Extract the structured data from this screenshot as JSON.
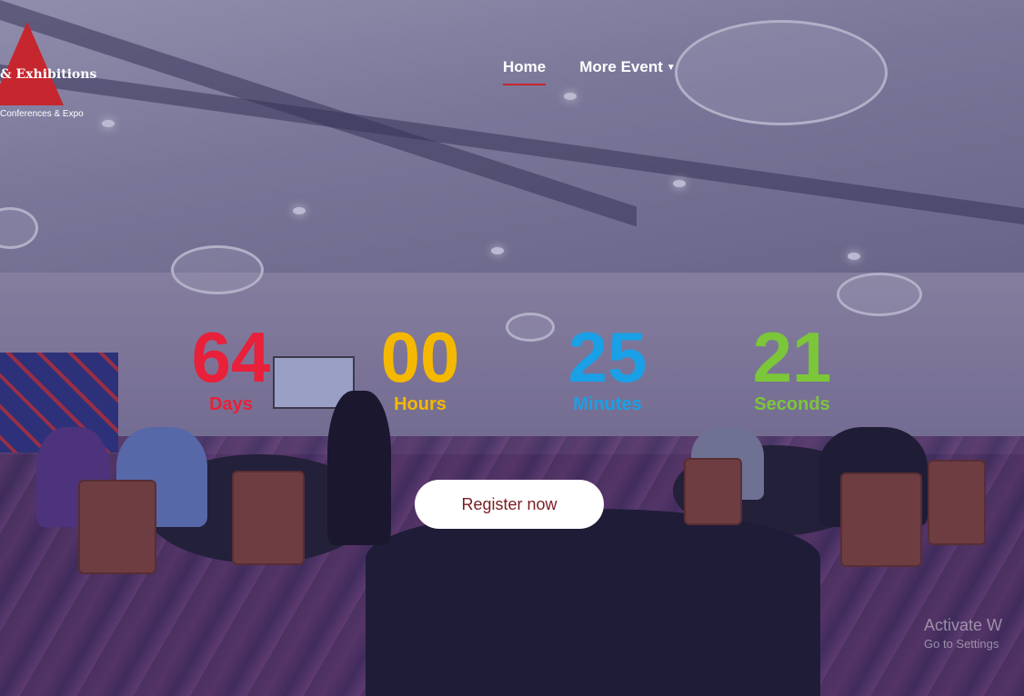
{
  "logo": {
    "title": "& Exhibitions",
    "subtitle": "Conferences & Expo"
  },
  "nav": {
    "items": [
      {
        "label": "Home",
        "active": true
      },
      {
        "label": "More Event",
        "dropdown": true
      }
    ]
  },
  "countdown": {
    "units": [
      {
        "value": "64",
        "label": "Days",
        "color": "#e8203a"
      },
      {
        "value": "00",
        "label": "Hours",
        "color": "#f5b800"
      },
      {
        "value": "25",
        "label": "Minutes",
        "color": "#1aa0e6"
      },
      {
        "value": "21",
        "label": "Seconds",
        "color": "#7cc63a"
      }
    ]
  },
  "cta": {
    "register_label": "Register now"
  },
  "watermark": {
    "line1": "Activate W",
    "line2": "Go to Settings"
  },
  "colors": {
    "brand_red": "#c6262e",
    "button_text": "#7a1d22"
  },
  "icons": {
    "dropdown": "chevron-down-icon",
    "logo": "triangle-logo-icon"
  }
}
